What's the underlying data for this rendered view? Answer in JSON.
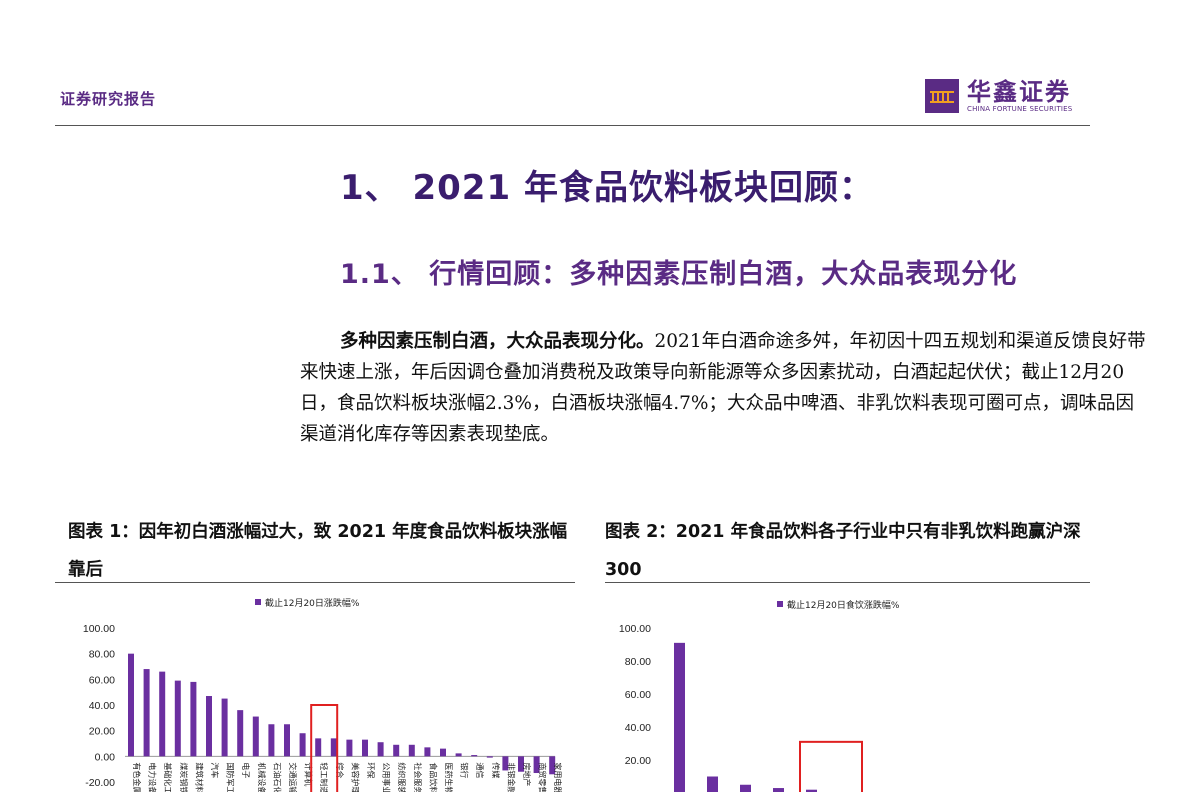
{
  "header": {
    "report_type": "证券研究报告",
    "logo_cn": "华鑫证券",
    "logo_en": "CHINA FORTUNE SECURITIES"
  },
  "section": {
    "h1": "1、 2021 年食品饮料板块回顾：",
    "h2": "1.1、 行情回顾：多种因素压制白酒，大众品表现分化"
  },
  "body": {
    "lead": "多种因素压制白酒，大众品表现分化。",
    "text": "2021年白酒命途多舛，年初因十四五规划和渠道反馈良好带来快速上涨，年后因调仓叠加消费税及政策导向新能源等众多因素扰动，白酒起起伏伏；截止12月20日，食品饮料板块涨幅2.3%，白酒板块涨幅4.7%；大众品中啤酒、非乳饮料表现可圈可点，调味品因渠道消化库存等因素表现垫底。"
  },
  "figures": {
    "fig1_title": "图表 1：因年初白酒涨幅过大，致 2021 年度食品饮料板块涨幅靠后",
    "fig2_title": "图表 2：2021 年食品饮料各子行业中只有非乳饮料跑赢沪深 300"
  },
  "chart_data": [
    {
      "type": "bar",
      "legend": "截止12月20日涨跌幅%",
      "color": "#6a2fa0",
      "highlight_color": "#e02020",
      "highlight_category_index": 12,
      "y_ticks": [
        "100.00",
        "80.00",
        "60.00",
        "40.00",
        "20.00",
        "0.00",
        "-20.00"
      ],
      "ylim": [
        -20,
        100
      ],
      "category_labels": [
        "有色金属",
        "电力设备",
        "基础化工",
        "煤炭钢铁",
        "建筑材料",
        "汽车",
        "国防军工",
        "电子",
        "机械设备",
        "石油石化",
        "交通运输",
        "计算机",
        "轻工制造",
        "综合",
        "美容护理",
        "环保",
        "公用事业",
        "纺织服装",
        "社会服务",
        "食品饮料",
        "医药生物",
        "银行",
        "通信",
        "传媒",
        "非银金融",
        "房地产",
        "商贸零售",
        "家用电器"
      ],
      "values": [
        80,
        68,
        66,
        59,
        58,
        47,
        45,
        36,
        31,
        25,
        25,
        18,
        14,
        14,
        13,
        13,
        11,
        9,
        9,
        7,
        6,
        2.3,
        1,
        -1,
        -11,
        -12,
        -13,
        -14
      ]
    },
    {
      "type": "bar",
      "legend": "截止12月20日食饮涨跌幅%",
      "color": "#6a2fa0",
      "highlight_color": "#e02020",
      "y_ticks": [
        "100.00",
        "80.00",
        "60.00",
        "40.00",
        "20.00"
      ],
      "ylim": [
        0,
        100
      ],
      "values": [
        91,
        10,
        5,
        3,
        2
      ]
    }
  ]
}
